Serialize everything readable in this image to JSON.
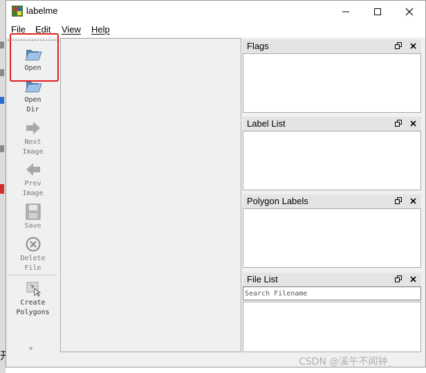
{
  "window": {
    "title": "labelme"
  },
  "menu": [
    "File",
    "Edit",
    "View",
    "Help"
  ],
  "toolbar": {
    "open": "Open",
    "open_dir": "Open\nDir",
    "next_image": "Next\nImage",
    "prev_image": "Prev\nImage",
    "save": "Save",
    "delete_file": "Delete\nFile",
    "create_polygons": "Create\nPolygons",
    "more_chevron": "»"
  },
  "docks": {
    "flags": "Flags",
    "label_list": "Label List",
    "polygon_labels": "Polygon Labels",
    "file_list": "File List",
    "search_placeholder": "Search Filename"
  },
  "watermark": "CSDN @溪午不闻钟_",
  "background_glyph": "开",
  "colors": {
    "highlight": "#e01e1e",
    "dock_title": "#e4e4e4",
    "window": "#f0f0f0"
  }
}
